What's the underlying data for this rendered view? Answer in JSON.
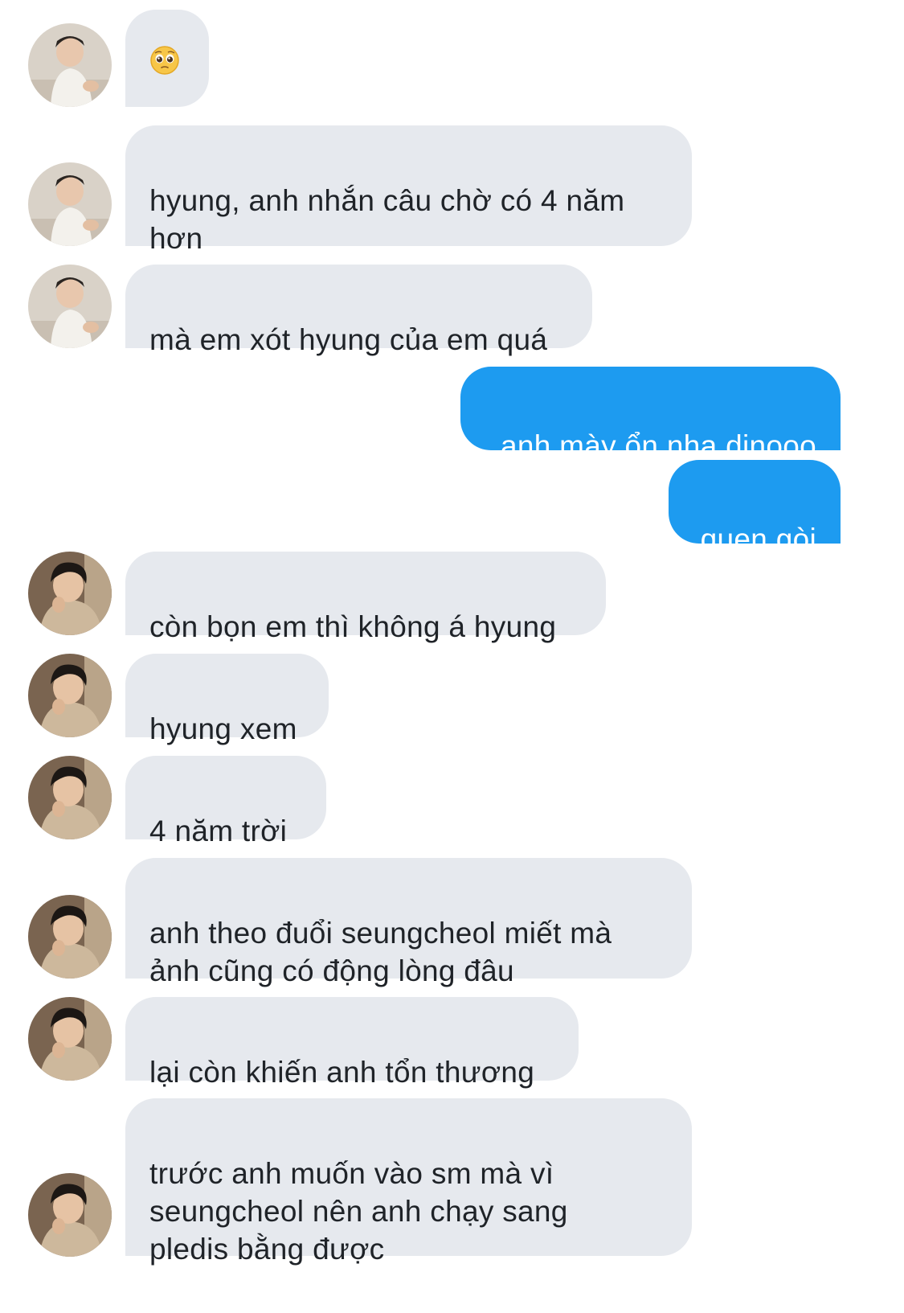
{
  "conversation": {
    "messages": [
      {
        "text": "🥺",
        "emoji": "pleading-face",
        "from": "other"
      },
      {
        "text": "hyung, anh nhắn câu chờ có 4 năm\nhơn",
        "from": "other"
      },
      {
        "text": "mà em xót hyung của em quá",
        "from": "other"
      },
      {
        "text": "anh mày ổn nha dinooo",
        "from": "me"
      },
      {
        "text": "quen gòi",
        "from": "me"
      },
      {
        "text": "còn bọn em thì không á hyung",
        "from": "other"
      },
      {
        "text": "hyung xem",
        "from": "other"
      },
      {
        "text": "4 năm trời",
        "from": "other"
      },
      {
        "text": "anh theo đuổi seungcheol miết mà\nảnh cũng có động lòng đâu",
        "from": "other"
      },
      {
        "text": "lại còn khiến anh tổn thương",
        "from": "other"
      },
      {
        "text": "trước anh muốn vào sm mà vì\nseungcheol nên anh chạy sang\npledis bằng được",
        "from": "other"
      }
    ]
  },
  "colors": {
    "received_bubble": "#e6e9ee",
    "sent_bubble": "#1d9bf0",
    "received_text": "#1f2328",
    "sent_text": "#ffffff"
  },
  "icons": {
    "avatar_a": "avatar-white-shirt-person",
    "avatar_b": "avatar-hooded-person"
  }
}
